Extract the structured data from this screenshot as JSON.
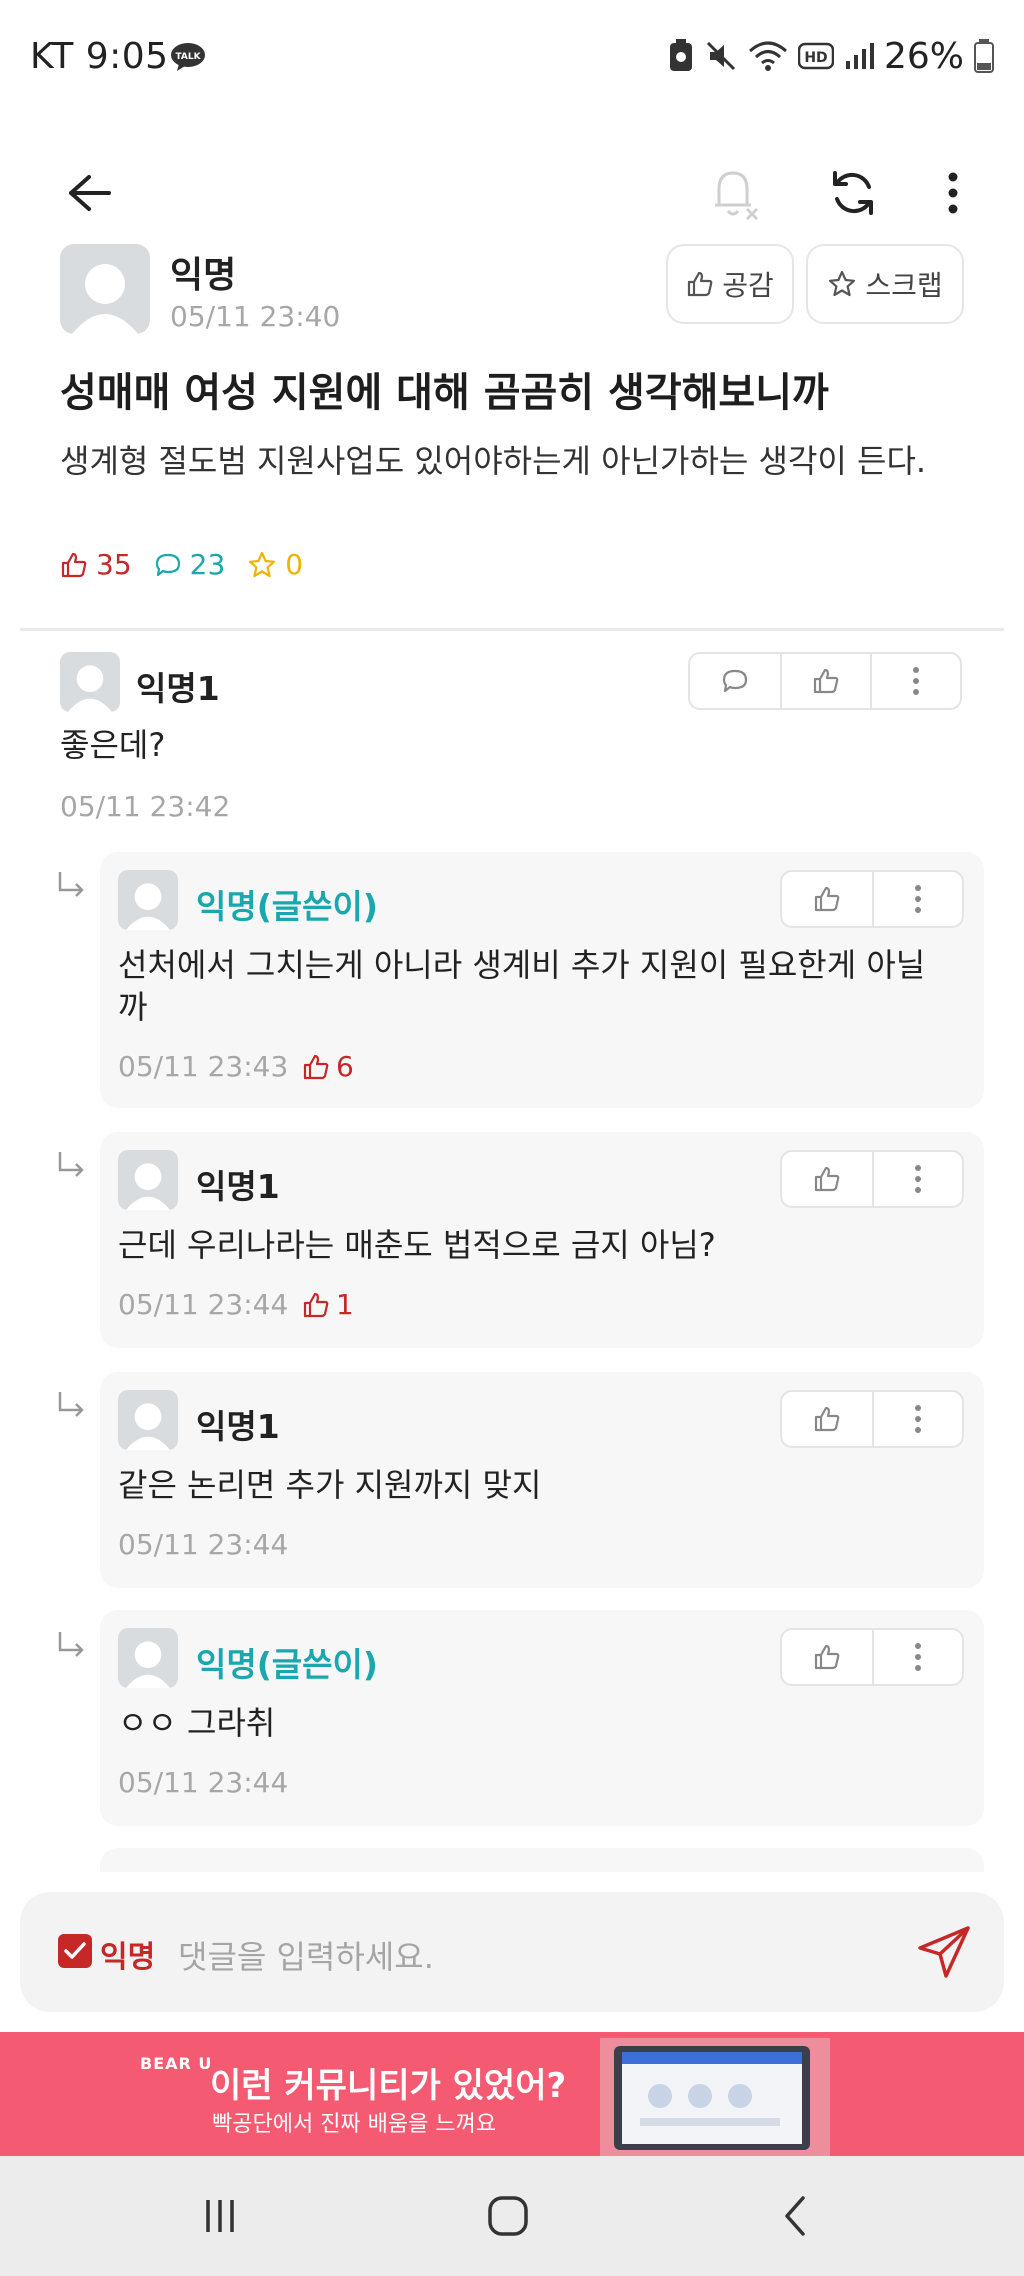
{
  "status_bar": {
    "carrier_time": "KT 9:05",
    "battery": "26%"
  },
  "post": {
    "author": "익명",
    "time": "05/11 23:40",
    "empathy_label": "공감",
    "scrap_label": "스크랩",
    "title": "성매매 여성 지원에 대해 곰곰히 생각해보니까",
    "body": "생계형 절도범 지원사업도 있어야하는게 아닌가하는 생각이 든다.",
    "likes": "35",
    "comments": "23",
    "scraps": "0"
  },
  "comments": [
    {
      "name": "익명1",
      "text": "좋은데?",
      "time": "05/11 23:42"
    }
  ],
  "replies": [
    {
      "name": "익명(글쓴이)",
      "text": "선처에서 그치는게 아니라 생계비 추가 지원이 필요한게 아닐까",
      "time": "05/11 23:43",
      "likes": "6"
    },
    {
      "name": "익명1",
      "text": "근데 우리나라는 매춘도 법적으로 금지 아님?",
      "time": "05/11 23:44",
      "likes": "1"
    },
    {
      "name": "익명1",
      "text": "같은 논리면 추가 지원까지 맞지",
      "time": "05/11 23:44"
    },
    {
      "name": "익명(글쓴이)",
      "text": "ㅇㅇ 그라취",
      "time": "05/11 23:44"
    }
  ],
  "comment_input": {
    "anon_label": "익명",
    "placeholder": "댓글을 입력하세요."
  },
  "ad": {
    "brand": "BEAR U",
    "headline": "이런 커뮤니티가 있었어?",
    "subline": "빡공단에서 진짜 배움을 느껴요"
  },
  "colors": {
    "accent_red": "#c62828",
    "writer_teal": "#1aa7ad",
    "scrap_yellow": "#f0b400",
    "ad_pink": "#f45a72"
  }
}
